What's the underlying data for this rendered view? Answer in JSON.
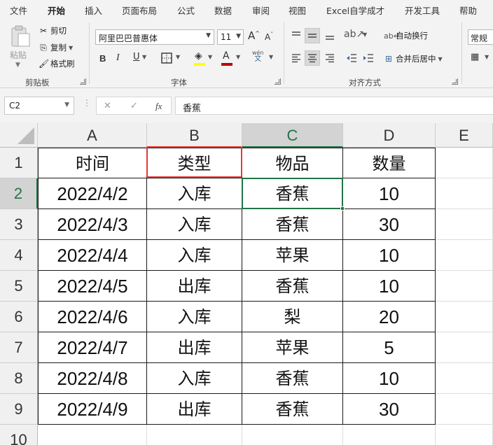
{
  "ribbon": {
    "tabs": [
      "文件",
      "开始",
      "插入",
      "页面布局",
      "公式",
      "数据",
      "审阅",
      "视图",
      "Excel自学成才",
      "开发工具",
      "帮助"
    ],
    "active_tab": "开始",
    "clipboard": {
      "paste_label": "粘贴",
      "cut_label": "剪切",
      "copy_label": "复制",
      "format_painter_label": "格式刷",
      "group_label": "剪贴板"
    },
    "font": {
      "font_name": "阿里巴巴普惠体",
      "font_size": "11",
      "grow_label": "A",
      "shrink_label": "A",
      "bold_label": "B",
      "italic_label": "I",
      "font_color_label": "A",
      "phonetic_label": "wén",
      "group_label": "字体"
    },
    "alignment": {
      "wrap_text_label": "自动换行",
      "merge_center_label": "合并后居中",
      "group_label": "对齐方式"
    },
    "number": {
      "format_value": "常规"
    },
    "accent_color": "#217346"
  },
  "formula_bar": {
    "name_box": "C2",
    "fx_label": "fx",
    "formula": "香蕉"
  },
  "sheet": {
    "columns": [
      "A",
      "B",
      "C",
      "D",
      "E"
    ],
    "selected_column": "C",
    "selected_row": "2",
    "rows": [
      {
        "num": "1",
        "cells": [
          "时间",
          "类型",
          "物品",
          "数量"
        ]
      },
      {
        "num": "2",
        "cells": [
          "2022/4/2",
          "入库",
          "香蕉",
          "10"
        ]
      },
      {
        "num": "3",
        "cells": [
          "2022/4/3",
          "入库",
          "香蕉",
          "30"
        ]
      },
      {
        "num": "4",
        "cells": [
          "2022/4/4",
          "入库",
          "苹果",
          "10"
        ]
      },
      {
        "num": "5",
        "cells": [
          "2022/4/5",
          "出库",
          "香蕉",
          "10"
        ]
      },
      {
        "num": "6",
        "cells": [
          "2022/4/6",
          "入库",
          "梨",
          "20"
        ]
      },
      {
        "num": "7",
        "cells": [
          "2022/4/7",
          "出库",
          "苹果",
          "5"
        ]
      },
      {
        "num": "8",
        "cells": [
          "2022/4/8",
          "入库",
          "香蕉",
          "10"
        ]
      },
      {
        "num": "9",
        "cells": [
          "2022/4/9",
          "出库",
          "香蕉",
          "30"
        ]
      },
      {
        "num": "10",
        "cells": [
          "",
          "",
          "",
          ""
        ]
      }
    ],
    "highlight_color": "#e53935"
  }
}
